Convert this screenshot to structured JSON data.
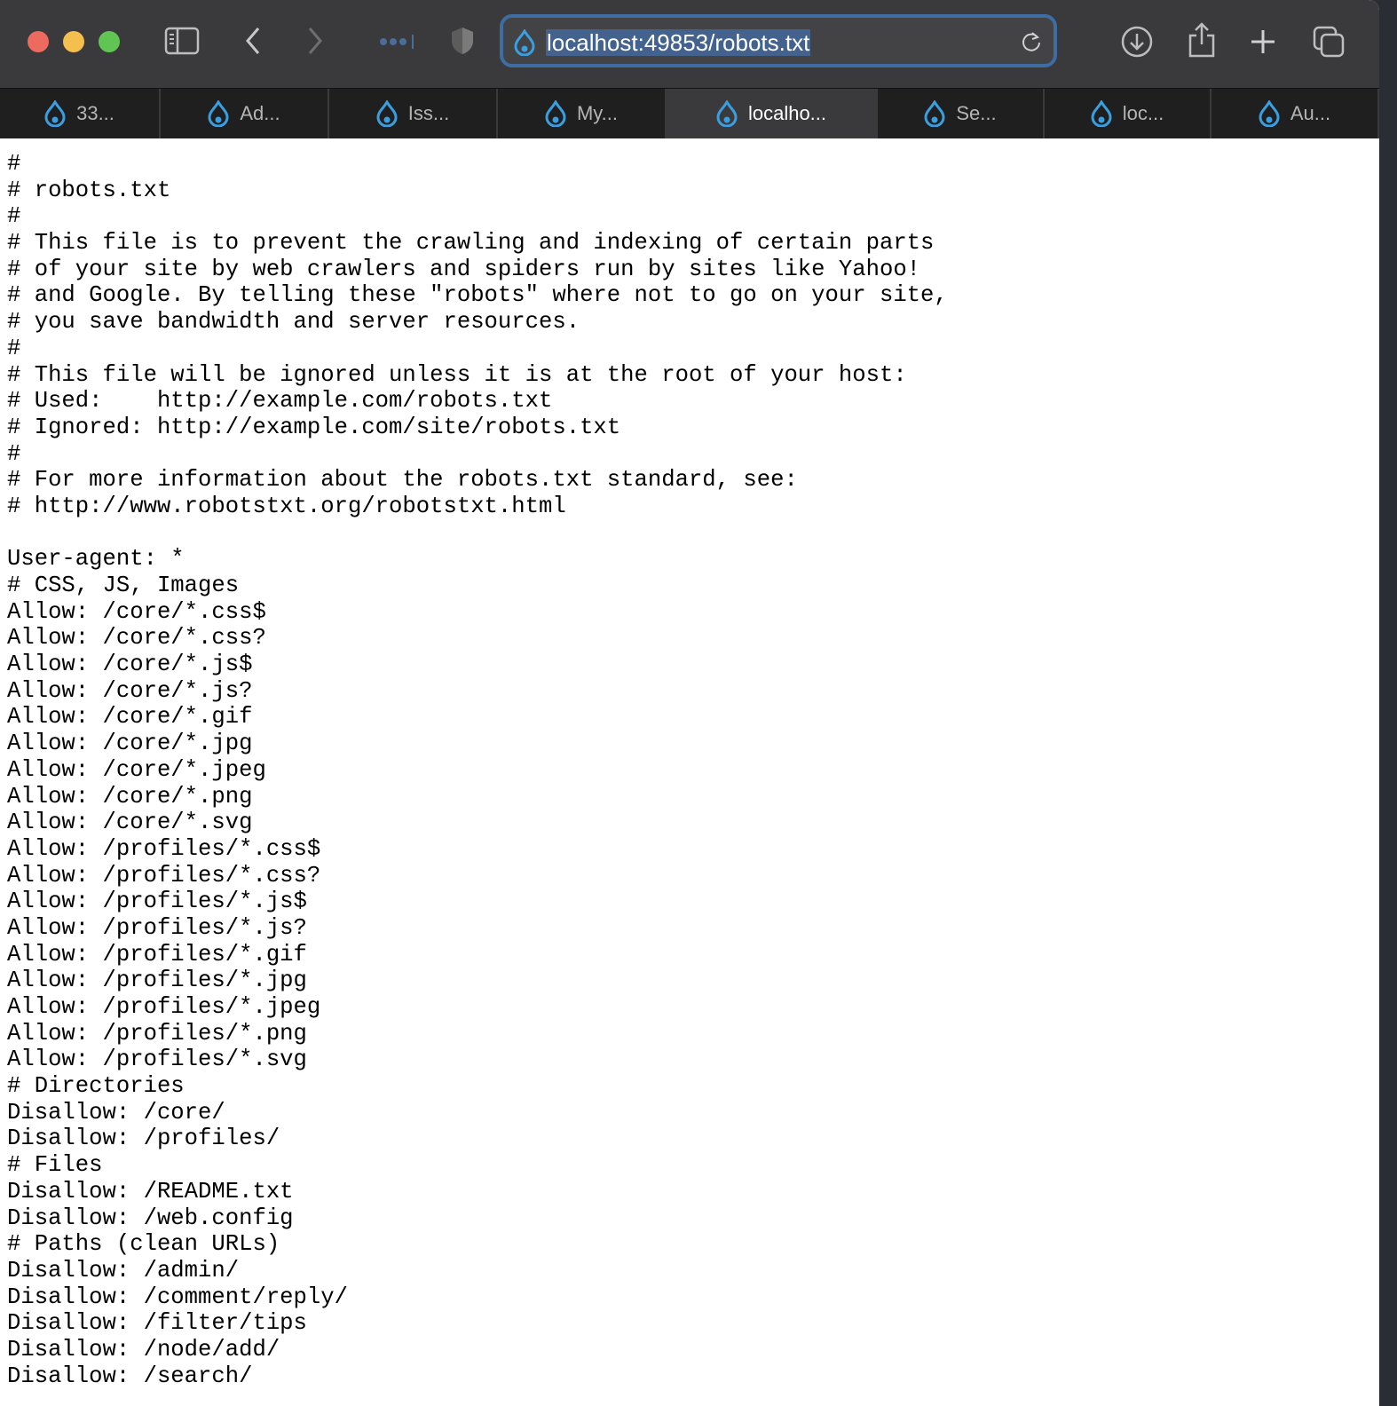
{
  "browser": {
    "url": "localhost:49853/robots.txt",
    "tabs": [
      {
        "label": "33...",
        "active": false
      },
      {
        "label": "Ad...",
        "active": false
      },
      {
        "label": "Iss...",
        "active": false
      },
      {
        "label": "My...",
        "active": false
      },
      {
        "label": "localho...",
        "active": true
      },
      {
        "label": "Se...",
        "active": false
      },
      {
        "label": "loc...",
        "active": false
      },
      {
        "label": "Au...",
        "active": false
      }
    ],
    "accent": "#3d6da3",
    "favicon_color": "#3a9fe0"
  },
  "document": {
    "lines": [
      "#",
      "# robots.txt",
      "#",
      "# This file is to prevent the crawling and indexing of certain parts",
      "# of your site by web crawlers and spiders run by sites like Yahoo!",
      "# and Google. By telling these \"robots\" where not to go on your site,",
      "# you save bandwidth and server resources.",
      "#",
      "# This file will be ignored unless it is at the root of your host:",
      "# Used:    http://example.com/robots.txt",
      "# Ignored: http://example.com/site/robots.txt",
      "#",
      "# For more information about the robots.txt standard, see:",
      "# http://www.robotstxt.org/robotstxt.html",
      "",
      "User-agent: *",
      "# CSS, JS, Images",
      "Allow: /core/*.css$",
      "Allow: /core/*.css?",
      "Allow: /core/*.js$",
      "Allow: /core/*.js?",
      "Allow: /core/*.gif",
      "Allow: /core/*.jpg",
      "Allow: /core/*.jpeg",
      "Allow: /core/*.png",
      "Allow: /core/*.svg",
      "Allow: /profiles/*.css$",
      "Allow: /profiles/*.css?",
      "Allow: /profiles/*.js$",
      "Allow: /profiles/*.js?",
      "Allow: /profiles/*.gif",
      "Allow: /profiles/*.jpg",
      "Allow: /profiles/*.jpeg",
      "Allow: /profiles/*.png",
      "Allow: /profiles/*.svg",
      "# Directories",
      "Disallow: /core/",
      "Disallow: /profiles/",
      "# Files",
      "Disallow: /README.txt",
      "Disallow: /web.config",
      "# Paths (clean URLs)",
      "Disallow: /admin/",
      "Disallow: /comment/reply/",
      "Disallow: /filter/tips",
      "Disallow: /node/add/",
      "Disallow: /search/"
    ]
  }
}
